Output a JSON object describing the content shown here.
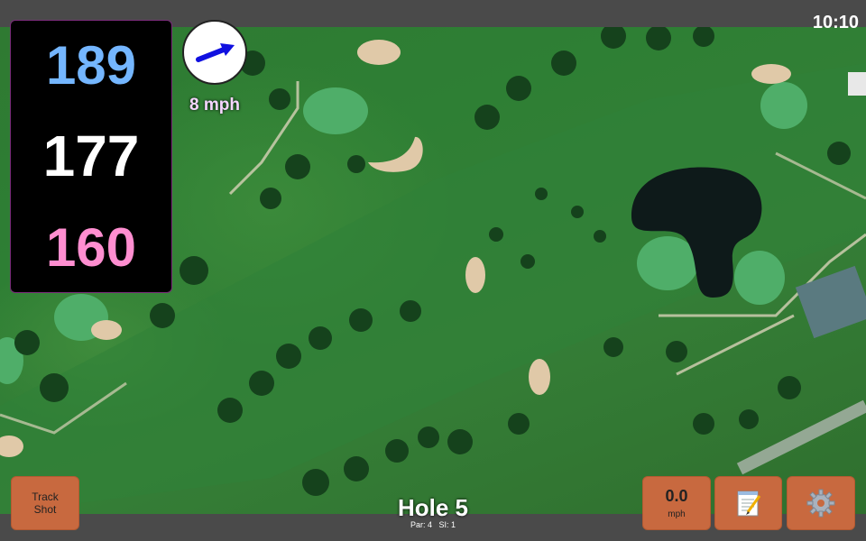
{
  "status": {
    "time": "10:10"
  },
  "distances": {
    "back": "189",
    "middle": "177",
    "front": "160"
  },
  "wind": {
    "speed_label": "8 mph",
    "value": "0.0",
    "unit": "mph"
  },
  "buttons": {
    "track_shot": "Track\nShot"
  },
  "hole": {
    "title": "Hole 5",
    "par_label": "Par: 4",
    "si_label": "SI: 1"
  },
  "icons": {
    "wind_arrow": "wind-arrow-icon",
    "notes": "notepad-icon",
    "settings": "gear-icon"
  },
  "colors": {
    "back_distance": "#74b6ff",
    "middle_distance": "#ffffff",
    "front_distance": "#ff8ed0",
    "button": "#c8693f",
    "bar": "#4a4a4a"
  }
}
